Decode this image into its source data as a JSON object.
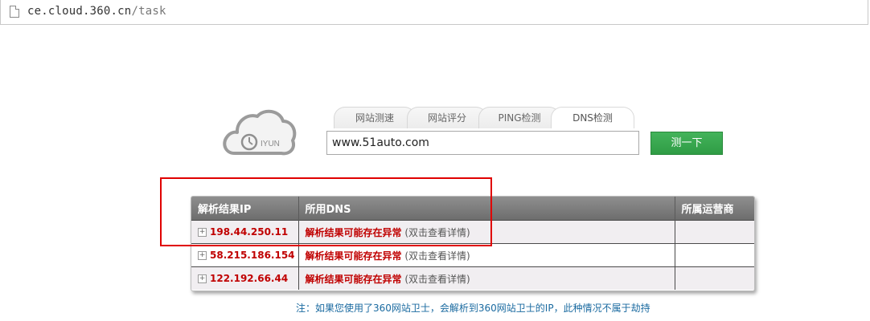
{
  "browser": {
    "url_host": "ce.cloud.360.cn",
    "url_path": "/task"
  },
  "logo": {
    "text": "IYUN",
    "icon": "cloud-logo-icon"
  },
  "tabs": [
    {
      "label": "网站测速"
    },
    {
      "label": "网站评分"
    },
    {
      "label": "PING检测"
    },
    {
      "label": "DNS检测",
      "active": true
    }
  ],
  "search": {
    "value": "www.51auto.com",
    "button_label": "测一下"
  },
  "table": {
    "headers": [
      "解析结果IP",
      "所用DNS",
      "所属运营商"
    ],
    "rows": [
      {
        "ip": "198.44.250.11",
        "dns_status": "解析结果可能存在异常",
        "detail": "(双击查看详情)",
        "isp": ""
      },
      {
        "ip": "58.215.186.154",
        "dns_status": "解析结果可能存在异常",
        "detail": "(双击查看详情)",
        "isp": ""
      },
      {
        "ip": "122.192.66.44",
        "dns_status": "解析结果可能存在异常",
        "detail": "(双击查看详情)",
        "isp": ""
      }
    ]
  },
  "note": "注：如果您使用了360网站卫士，会解析到360网站卫士的IP，此种情况不属于劫持",
  "colors": {
    "accent_green": "#2f9c45",
    "alert_red": "#c00000",
    "note_blue": "#1a6aa0"
  }
}
